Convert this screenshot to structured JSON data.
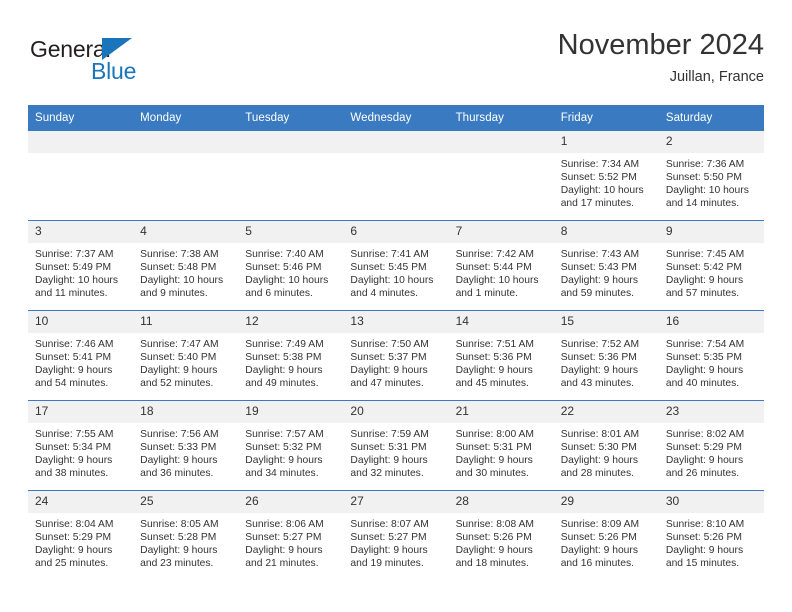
{
  "logo": {
    "word1": "General",
    "word2": "Blue",
    "triangle_color": "#1b75bb",
    "text_color": "#231f20"
  },
  "header": {
    "title": "November 2024",
    "subtitle": "Juillan, France"
  },
  "theme": {
    "header_blue": "#3a7ac0",
    "daynum_gray": "#f1f1f1",
    "text": "#333333"
  },
  "calendar": {
    "weekday_headers": [
      "Sunday",
      "Monday",
      "Tuesday",
      "Wednesday",
      "Thursday",
      "Friday",
      "Saturday"
    ],
    "weeks": [
      [
        {
          "day": "",
          "sunrise": "",
          "sunset": "",
          "daylight_line1": "",
          "daylight_line2": ""
        },
        {
          "day": "",
          "sunrise": "",
          "sunset": "",
          "daylight_line1": "",
          "daylight_line2": ""
        },
        {
          "day": "",
          "sunrise": "",
          "sunset": "",
          "daylight_line1": "",
          "daylight_line2": ""
        },
        {
          "day": "",
          "sunrise": "",
          "sunset": "",
          "daylight_line1": "",
          "daylight_line2": ""
        },
        {
          "day": "",
          "sunrise": "",
          "sunset": "",
          "daylight_line1": "",
          "daylight_line2": ""
        },
        {
          "day": "1",
          "sunrise": "Sunrise: 7:34 AM",
          "sunset": "Sunset: 5:52 PM",
          "daylight_line1": "Daylight: 10 hours",
          "daylight_line2": "and 17 minutes."
        },
        {
          "day": "2",
          "sunrise": "Sunrise: 7:36 AM",
          "sunset": "Sunset: 5:50 PM",
          "daylight_line1": "Daylight: 10 hours",
          "daylight_line2": "and 14 minutes."
        }
      ],
      [
        {
          "day": "3",
          "sunrise": "Sunrise: 7:37 AM",
          "sunset": "Sunset: 5:49 PM",
          "daylight_line1": "Daylight: 10 hours",
          "daylight_line2": "and 11 minutes."
        },
        {
          "day": "4",
          "sunrise": "Sunrise: 7:38 AM",
          "sunset": "Sunset: 5:48 PM",
          "daylight_line1": "Daylight: 10 hours",
          "daylight_line2": "and 9 minutes."
        },
        {
          "day": "5",
          "sunrise": "Sunrise: 7:40 AM",
          "sunset": "Sunset: 5:46 PM",
          "daylight_line1": "Daylight: 10 hours",
          "daylight_line2": "and 6 minutes."
        },
        {
          "day": "6",
          "sunrise": "Sunrise: 7:41 AM",
          "sunset": "Sunset: 5:45 PM",
          "daylight_line1": "Daylight: 10 hours",
          "daylight_line2": "and 4 minutes."
        },
        {
          "day": "7",
          "sunrise": "Sunrise: 7:42 AM",
          "sunset": "Sunset: 5:44 PM",
          "daylight_line1": "Daylight: 10 hours",
          "daylight_line2": "and 1 minute."
        },
        {
          "day": "8",
          "sunrise": "Sunrise: 7:43 AM",
          "sunset": "Sunset: 5:43 PM",
          "daylight_line1": "Daylight: 9 hours",
          "daylight_line2": "and 59 minutes."
        },
        {
          "day": "9",
          "sunrise": "Sunrise: 7:45 AM",
          "sunset": "Sunset: 5:42 PM",
          "daylight_line1": "Daylight: 9 hours",
          "daylight_line2": "and 57 minutes."
        }
      ],
      [
        {
          "day": "10",
          "sunrise": "Sunrise: 7:46 AM",
          "sunset": "Sunset: 5:41 PM",
          "daylight_line1": "Daylight: 9 hours",
          "daylight_line2": "and 54 minutes."
        },
        {
          "day": "11",
          "sunrise": "Sunrise: 7:47 AM",
          "sunset": "Sunset: 5:40 PM",
          "daylight_line1": "Daylight: 9 hours",
          "daylight_line2": "and 52 minutes."
        },
        {
          "day": "12",
          "sunrise": "Sunrise: 7:49 AM",
          "sunset": "Sunset: 5:38 PM",
          "daylight_line1": "Daylight: 9 hours",
          "daylight_line2": "and 49 minutes."
        },
        {
          "day": "13",
          "sunrise": "Sunrise: 7:50 AM",
          "sunset": "Sunset: 5:37 PM",
          "daylight_line1": "Daylight: 9 hours",
          "daylight_line2": "and 47 minutes."
        },
        {
          "day": "14",
          "sunrise": "Sunrise: 7:51 AM",
          "sunset": "Sunset: 5:36 PM",
          "daylight_line1": "Daylight: 9 hours",
          "daylight_line2": "and 45 minutes."
        },
        {
          "day": "15",
          "sunrise": "Sunrise: 7:52 AM",
          "sunset": "Sunset: 5:36 PM",
          "daylight_line1": "Daylight: 9 hours",
          "daylight_line2": "and 43 minutes."
        },
        {
          "day": "16",
          "sunrise": "Sunrise: 7:54 AM",
          "sunset": "Sunset: 5:35 PM",
          "daylight_line1": "Daylight: 9 hours",
          "daylight_line2": "and 40 minutes."
        }
      ],
      [
        {
          "day": "17",
          "sunrise": "Sunrise: 7:55 AM",
          "sunset": "Sunset: 5:34 PM",
          "daylight_line1": "Daylight: 9 hours",
          "daylight_line2": "and 38 minutes."
        },
        {
          "day": "18",
          "sunrise": "Sunrise: 7:56 AM",
          "sunset": "Sunset: 5:33 PM",
          "daylight_line1": "Daylight: 9 hours",
          "daylight_line2": "and 36 minutes."
        },
        {
          "day": "19",
          "sunrise": "Sunrise: 7:57 AM",
          "sunset": "Sunset: 5:32 PM",
          "daylight_line1": "Daylight: 9 hours",
          "daylight_line2": "and 34 minutes."
        },
        {
          "day": "20",
          "sunrise": "Sunrise: 7:59 AM",
          "sunset": "Sunset: 5:31 PM",
          "daylight_line1": "Daylight: 9 hours",
          "daylight_line2": "and 32 minutes."
        },
        {
          "day": "21",
          "sunrise": "Sunrise: 8:00 AM",
          "sunset": "Sunset: 5:31 PM",
          "daylight_line1": "Daylight: 9 hours",
          "daylight_line2": "and 30 minutes."
        },
        {
          "day": "22",
          "sunrise": "Sunrise: 8:01 AM",
          "sunset": "Sunset: 5:30 PM",
          "daylight_line1": "Daylight: 9 hours",
          "daylight_line2": "and 28 minutes."
        },
        {
          "day": "23",
          "sunrise": "Sunrise: 8:02 AM",
          "sunset": "Sunset: 5:29 PM",
          "daylight_line1": "Daylight: 9 hours",
          "daylight_line2": "and 26 minutes."
        }
      ],
      [
        {
          "day": "24",
          "sunrise": "Sunrise: 8:04 AM",
          "sunset": "Sunset: 5:29 PM",
          "daylight_line1": "Daylight: 9 hours",
          "daylight_line2": "and 25 minutes."
        },
        {
          "day": "25",
          "sunrise": "Sunrise: 8:05 AM",
          "sunset": "Sunset: 5:28 PM",
          "daylight_line1": "Daylight: 9 hours",
          "daylight_line2": "and 23 minutes."
        },
        {
          "day": "26",
          "sunrise": "Sunrise: 8:06 AM",
          "sunset": "Sunset: 5:27 PM",
          "daylight_line1": "Daylight: 9 hours",
          "daylight_line2": "and 21 minutes."
        },
        {
          "day": "27",
          "sunrise": "Sunrise: 8:07 AM",
          "sunset": "Sunset: 5:27 PM",
          "daylight_line1": "Daylight: 9 hours",
          "daylight_line2": "and 19 minutes."
        },
        {
          "day": "28",
          "sunrise": "Sunrise: 8:08 AM",
          "sunset": "Sunset: 5:26 PM",
          "daylight_line1": "Daylight: 9 hours",
          "daylight_line2": "and 18 minutes."
        },
        {
          "day": "29",
          "sunrise": "Sunrise: 8:09 AM",
          "sunset": "Sunset: 5:26 PM",
          "daylight_line1": "Daylight: 9 hours",
          "daylight_line2": "and 16 minutes."
        },
        {
          "day": "30",
          "sunrise": "Sunrise: 8:10 AM",
          "sunset": "Sunset: 5:26 PM",
          "daylight_line1": "Daylight: 9 hours",
          "daylight_line2": "and 15 minutes."
        }
      ]
    ]
  }
}
